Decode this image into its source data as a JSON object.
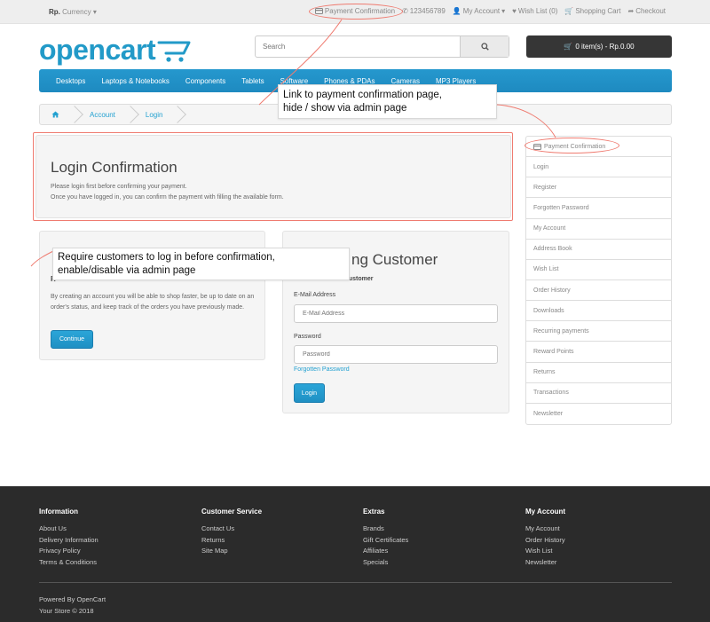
{
  "topbar": {
    "currency_symbol": "Rp.",
    "currency_label": "Currency",
    "payment_confirmation": "Payment Confirmation",
    "phone": "123456789",
    "my_account": "My Account",
    "wish_list": "Wish List (0)",
    "shopping_cart": "Shopping Cart",
    "checkout": "Checkout"
  },
  "header": {
    "logo": "opencart",
    "search_placeholder": "Search",
    "cart_summary": "0 item(s) - Rp.0.00"
  },
  "menu": [
    "Desktops",
    "Laptops & Notebooks",
    "Components",
    "Tablets",
    "Software",
    "Phones & PDAs",
    "Cameras",
    "MP3 Players"
  ],
  "breadcrumb": [
    "Account",
    "Login"
  ],
  "confirmation": {
    "title": "Login Confirmation",
    "line1": "Please login first before confirming your payment.",
    "line2": "Once you have logged in, you can confirm the payment with filling the available form."
  },
  "new_customer": {
    "heading_partial": "R",
    "text": "By creating an account you will be able to shop faster, be up to date on an order's status, and keep track of the orders you have previously made.",
    "continue": "Continue"
  },
  "returning": {
    "title_partial": "ng Customer",
    "subtitle_partial": "customer",
    "email_label": "E-Mail Address",
    "email_placeholder": "E-Mail Address",
    "password_label": "Password",
    "password_placeholder": "Password",
    "forgotten": "Forgotten Password",
    "login": "Login"
  },
  "sidebar": [
    "Payment Confirmation",
    "Login",
    "Register",
    "Forgotten Password",
    "My Account",
    "Address Book",
    "Wish List",
    "Order History",
    "Downloads",
    "Recurring payments",
    "Reward Points",
    "Returns",
    "Transactions",
    "Newsletter"
  ],
  "annotations": {
    "note1_line1": "Link to payment confirmation page,",
    "note1_line2": "hide / show via admin page",
    "note2_line1": "Require customers to log in before confirmation,",
    "note2_line2": "enable/disable via admin page"
  },
  "footer": {
    "information": {
      "title": "Information",
      "links": [
        "About Us",
        "Delivery Information",
        "Privacy Policy",
        "Terms & Conditions"
      ]
    },
    "customer_service": {
      "title": "Customer Service",
      "links": [
        "Contact Us",
        "Returns",
        "Site Map"
      ]
    },
    "extras": {
      "title": "Extras",
      "links": [
        "Brands",
        "Gift Certificates",
        "Affiliates",
        "Specials"
      ]
    },
    "my_account": {
      "title": "My Account",
      "links": [
        "My Account",
        "Order History",
        "Wish List",
        "Newsletter"
      ]
    },
    "powered": "Powered By OpenCart",
    "copyright": "Your Store © 2018"
  },
  "colors": {
    "accent": "#229ac8",
    "annotation": "#ef7b70",
    "footer_bg": "#2b2b2b"
  }
}
